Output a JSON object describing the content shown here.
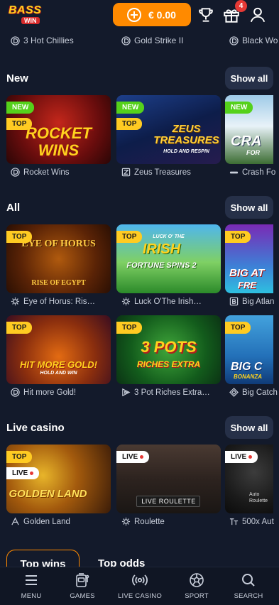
{
  "header": {
    "logo_top": "BASS",
    "logo_bottom": "WIN",
    "balance": "€ 0.00",
    "gift_badge": "4"
  },
  "recent": [
    {
      "name": "3 Hot Chillies",
      "icon": "provider-d-icon"
    },
    {
      "name": "Gold Strike II",
      "icon": "provider-d-icon"
    },
    {
      "name": "Black Wo",
      "icon": "provider-d-icon"
    }
  ],
  "sections": {
    "new": {
      "title": "New",
      "show_all": "Show all",
      "games": [
        {
          "name": "Rocket Wins",
          "art": "ROCKET WINS",
          "tags": [
            "NEW",
            "TOP"
          ]
        },
        {
          "name": "Zeus Treasures",
          "art": "ZEUS TREASURES",
          "art_sub": "HOLD AND RESPIN",
          "tags": [
            "NEW",
            "TOP"
          ]
        },
        {
          "name": "Crash Fo",
          "art": "CRA",
          "art_sub": "FOR",
          "tags": [
            "NEW"
          ]
        }
      ]
    },
    "all": {
      "title": "All",
      "show_all": "Show all",
      "games": [
        {
          "name": "Eye of Horus: Ris…",
          "art": "EYE OF HORUS",
          "art_sub": "RISE OF EGYPT",
          "tags": [
            "TOP"
          ]
        },
        {
          "name": "Luck O'The Irish…",
          "art": "IRISH",
          "art_sub": "FORTUNE SPINS 2",
          "art_top": "LUCK O' THE",
          "tags": [
            "TOP"
          ]
        },
        {
          "name": "Big Atlan",
          "art": "BIG AT",
          "art_sub": "FRE",
          "tags": [
            "TOP"
          ]
        },
        {
          "name": "Hit more Gold!",
          "art": "HIT MORE GOLD!",
          "art_sub": "HOLD AND WIN",
          "tags": [
            "TOP"
          ]
        },
        {
          "name": "3 Pot Riches Extra…",
          "art": "3 POTS",
          "art_sub": "RICHES EXTRA",
          "tags": [
            "TOP"
          ]
        },
        {
          "name": "Big Catch",
          "art": "BIG C",
          "art_sub": "BONANZA",
          "tags": [
            "TOP"
          ]
        }
      ]
    },
    "live": {
      "title": "Live casino",
      "show_all": "Show all",
      "games": [
        {
          "name": "Golden Land",
          "art": "GOLDEN LAND",
          "tags": [
            "TOP",
            "LIVE"
          ]
        },
        {
          "name": "Roulette",
          "art": "LIVE ROULETTE",
          "tags": [
            "LIVE"
          ]
        },
        {
          "name": "500x Aut",
          "art": "Auto Roulette",
          "tags": [
            "LIVE"
          ]
        }
      ]
    }
  },
  "tabs": {
    "active": "Top wins",
    "inactive": "Top odds"
  },
  "nav": [
    {
      "label": "MENU",
      "icon": "menu-icon"
    },
    {
      "label": "GAMES",
      "icon": "slot-machine-icon"
    },
    {
      "label": "LIVE CASINO",
      "icon": "live-broadcast-icon"
    },
    {
      "label": "SPORT",
      "icon": "soccer-ball-icon"
    },
    {
      "label": "SEARCH",
      "icon": "search-icon"
    }
  ],
  "colors": {
    "background": "#131a2b",
    "accent": "#ff8a00",
    "new_tag": "#55d11b",
    "top_tag": "#ffcb22",
    "show_all_bg": "#263048"
  }
}
